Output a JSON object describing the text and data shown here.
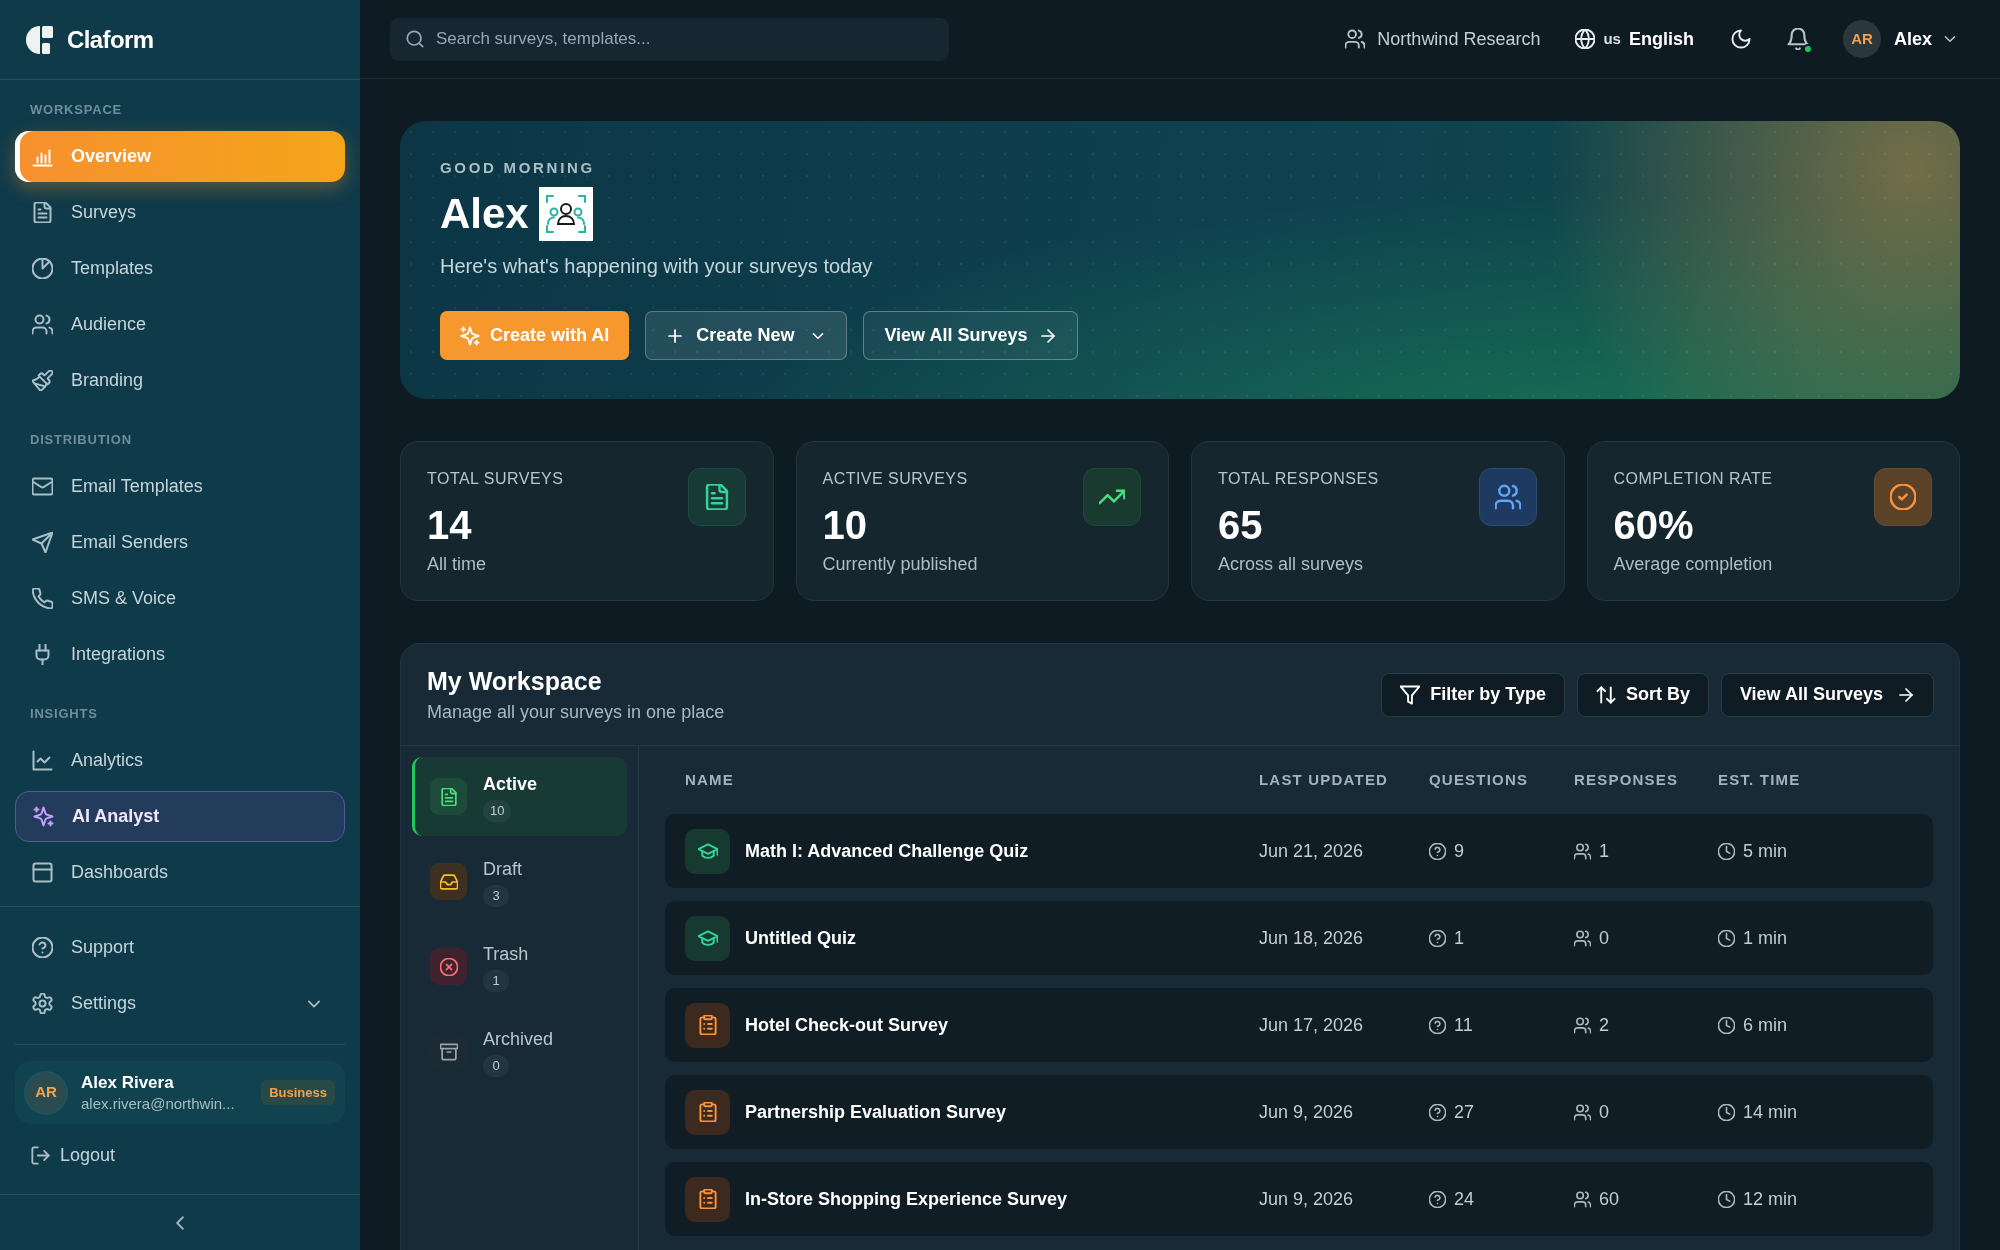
{
  "sidebar": {
    "brand": "Claform",
    "sections": [
      {
        "heading": "WORKSPACE",
        "items": [
          {
            "label": "Overview",
            "kind": "link",
            "selected": true
          },
          {
            "label": "Surveys",
            "kind": "link",
            "selected": false
          },
          {
            "label": "Templates",
            "kind": "link",
            "selected": false
          },
          {
            "label": "Audience",
            "kind": "link",
            "selected": false
          },
          {
            "label": "Branding",
            "kind": "link",
            "selected": false
          }
        ]
      },
      {
        "heading": "DISTRIBUTION",
        "items": [
          {
            "label": "Email Templates",
            "kind": "link",
            "selected": false
          },
          {
            "label": "Email Senders",
            "kind": "link",
            "selected": false
          },
          {
            "label": "SMS & Voice",
            "kind": "link",
            "selected": false
          },
          {
            "label": "Integrations",
            "kind": "link",
            "selected": false
          }
        ]
      },
      {
        "heading": "INSIGHTS",
        "items": [
          {
            "label": "Analytics",
            "kind": "link",
            "selected": false
          },
          {
            "label": "AI Analyst",
            "kind": "ai",
            "selected": false
          },
          {
            "label": "Dashboards",
            "kind": "link",
            "selected": false
          }
        ]
      }
    ],
    "footer_items": [
      {
        "label": "Support",
        "kind": "link",
        "selected": false
      },
      {
        "label": "Settings",
        "kind": "group",
        "selected": false,
        "expanded": false
      }
    ],
    "user": {
      "initials": "AR",
      "name": "Alex Rivera",
      "email": "alex.rivera@northwin...",
      "plan": "Business"
    },
    "logout": "Logout"
  },
  "header": {
    "search": {
      "placeholder": "Search surveys, templates..."
    },
    "organization": "Northwind Research",
    "language": {
      "code": "us",
      "label": "English"
    },
    "notifications": {
      "unread": true
    },
    "user": {
      "initials": "AR",
      "name": "Alex"
    }
  },
  "hero": {
    "greeting": "GOOD MORNING",
    "name": "Alex",
    "subtitle": "Here's what's happening with your surveys today",
    "buttons": [
      {
        "label": "Create with AI",
        "kind": "ai"
      },
      {
        "label": "Create New",
        "kind": "menu"
      },
      {
        "label": "View All Surveys",
        "kind": "link"
      }
    ]
  },
  "stats": [
    {
      "label": "TOTAL SURVEYS",
      "value": "14",
      "caption": "All time"
    },
    {
      "label": "ACTIVE SURVEYS",
      "value": "10",
      "caption": "Currently published"
    },
    {
      "label": "TOTAL RESPONSES",
      "value": "65",
      "caption": "Across all surveys"
    },
    {
      "label": "COMPLETION RATE",
      "value": "60%",
      "caption": "Average completion"
    }
  ],
  "workspace": {
    "title": "My Workspace",
    "subtitle": "Manage all your surveys in one place",
    "actions": [
      {
        "label": "Filter by Type",
        "kind": "filter"
      },
      {
        "label": "Sort By",
        "kind": "sort"
      },
      {
        "label": "View All Surveys",
        "kind": "link"
      }
    ],
    "tabs": [
      {
        "label": "Active",
        "count": "10",
        "selected": true
      },
      {
        "label": "Draft",
        "count": "3",
        "selected": false
      },
      {
        "label": "Trash",
        "count": "1",
        "selected": false
      },
      {
        "label": "Archived",
        "count": "0",
        "selected": false
      }
    ],
    "table": {
      "columns": [
        "NAME",
        "LAST UPDATED",
        "QUESTIONS",
        "RESPONSES",
        "EST. TIME"
      ],
      "rows": [
        {
          "kind": "quiz",
          "name": "Math I: Advanced Challenge Quiz",
          "updated": "Jun 21, 2026",
          "questions": "9",
          "responses": "1",
          "time": "5 min"
        },
        {
          "kind": "quiz",
          "name": "Untitled Quiz",
          "updated": "Jun 18, 2026",
          "questions": "1",
          "responses": "0",
          "time": "1 min"
        },
        {
          "kind": "survey",
          "name": "Hotel Check-out Survey",
          "updated": "Jun 17, 2026",
          "questions": "11",
          "responses": "2",
          "time": "6 min"
        },
        {
          "kind": "survey",
          "name": "Partnership Evaluation Survey",
          "updated": "Jun 9, 2026",
          "questions": "27",
          "responses": "0",
          "time": "14 min"
        },
        {
          "kind": "survey",
          "name": "In-Store Shopping Experience Survey",
          "updated": "Jun 9, 2026",
          "questions": "24",
          "responses": "60",
          "time": "12 min"
        }
      ]
    }
  }
}
